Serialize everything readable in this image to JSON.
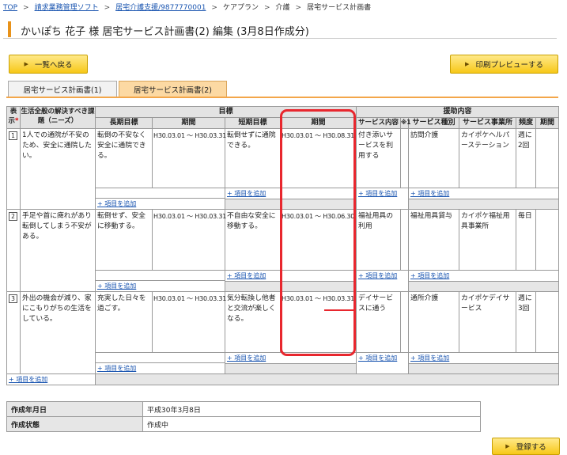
{
  "breadcrumb": {
    "top": "TOP",
    "billing": "請求業務管理ソフト",
    "office": "居宅介護支援/9877770001",
    "careplan": "ケアプラン",
    "care": "介護",
    "current": "居宅サービス計画書"
  },
  "page_title": "かいぽち 花子 様 居宅サービス計画書(2) 編集 (3月8日作成分)",
  "buttons": {
    "back": "一覧へ戻る",
    "print_preview": "印刷プレビューする",
    "register": "登録する"
  },
  "tabs": [
    {
      "label": "居宅サービス計画書(1)"
    },
    {
      "label": "居宅サービス計画書(2)"
    }
  ],
  "table": {
    "hdr_display": "表示",
    "hdr_needs": "生活全般の解決すべき課題（ニーズ）",
    "hdr_goal": "目標",
    "hdr_long": "長期目標",
    "hdr_period": "期間",
    "hdr_short": "短期目標",
    "hdr_period2": "期間",
    "hdr_assist": "援助内容",
    "hdr_service_content": "サービス内容",
    "hdr_mark": "※1",
    "hdr_service_type": "サービス種別",
    "hdr_provider": "サービス事業所",
    "hdr_frequency": "頻度",
    "hdr_period3": "期間",
    "add_label": "+ 項目を追加",
    "rows": [
      {
        "no": "1",
        "needs": "1人での通院が不安のため、安全に通院したい。",
        "long_goal": "転倒の不安なく安全に通院できる。",
        "long_period": "H30.03.01 ～ H30.03.31",
        "short_goal": "転倒せずに通院できる。",
        "short_period": "H30.03.01 ～ H30.08.31",
        "service_content": "付き添いサービスを利用する",
        "service_type": "訪問介護",
        "provider": "カイポケヘルパーステーション",
        "frequency": "週に2回"
      },
      {
        "no": "2",
        "needs": "手足や首に痺れがあり転倒してしまう不安がある。",
        "long_goal": "転倒せず、安全に移動する。",
        "long_period": "H30.03.01 ～ H30.03.31",
        "short_goal": "不自由な安全に移動する。",
        "short_period": "H30.03.01 ～ H30.06.30",
        "service_content": "福祉用具の利用",
        "service_type": "福祉用具貸与",
        "provider": "カイポケ福祉用具事業所",
        "frequency": "毎日"
      },
      {
        "no": "3",
        "needs": "外出の機会が減り、家にこもりがちの生活をしている。",
        "long_goal": "充実した日々を過ごす。",
        "long_period": "H30.03.01 ～ H30.03.31",
        "short_goal": "気分転換し他者と交流が楽しくなる。",
        "short_period_start": "H30.03.01 ～ ",
        "short_period_end": "H30.03.31",
        "service_content": "デイサービスに通う",
        "service_type": "通所介護",
        "provider": "カイポケデイサービス",
        "frequency": "週に3回"
      }
    ]
  },
  "meta": {
    "created_label": "作成年月日",
    "created_value": "平成30年3月8日",
    "status_label": "作成状態",
    "status_value": "作成中"
  },
  "colors": {
    "accent_orange": "#f3a64a",
    "button_yellow": "#f7c818",
    "highlight_red": "#e8272e",
    "link_blue": "#1a55b0"
  }
}
